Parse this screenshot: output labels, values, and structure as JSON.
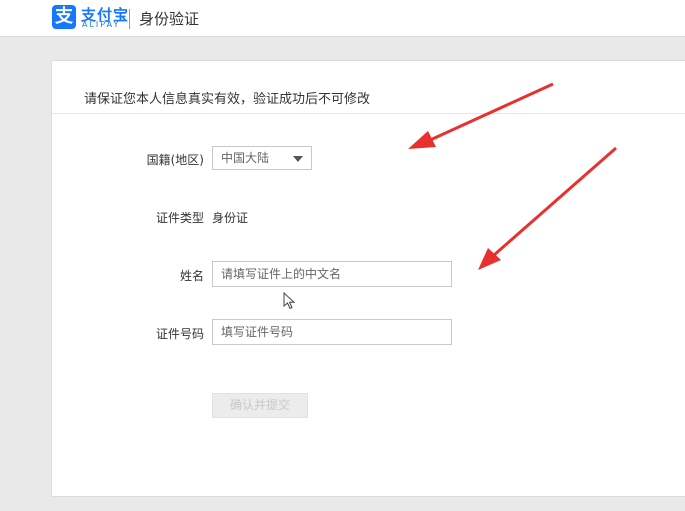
{
  "header": {
    "logo_icon": "支",
    "logo_cn": "支付宝",
    "logo_en": "ALIPAY",
    "title": "身份验证"
  },
  "notice": "请保证您本人信息真实有效，验证成功后不可修改",
  "form": {
    "nationality_label": "国籍(地区)",
    "nationality_value": "中国大陆",
    "id_type_label": "证件类型",
    "id_type_value": "身份证",
    "name_label": "姓名",
    "name_placeholder": "请填写证件上的中文名",
    "id_number_label": "证件号码",
    "id_number_placeholder": "填写证件号码",
    "submit_label": "确认并提交"
  },
  "colors": {
    "brand": "#1677ff",
    "arrow": "#e8312f"
  }
}
